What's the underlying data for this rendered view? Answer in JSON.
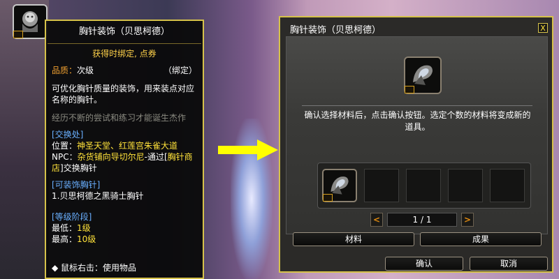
{
  "tooltip": {
    "title": "胸针装饰（贝思柯德）",
    "bind_note": "获得时绑定, 点券",
    "grade_label": "品质：",
    "grade_value": "次级",
    "bound_status": "（绑定）",
    "description": "可优化胸针质量的装饰，用来装点对应名称的胸针。",
    "flavor": "经历不断的尝试和练习才能诞生杰作",
    "exchange_header": "[交换处]",
    "location_label": "位置：",
    "location_value": "神圣天堂、红莲宫朱雀大道",
    "npc_label": "NPC：",
    "npc_value": "杂货铺向导切尔尼",
    "npc_via": "-通过[",
    "npc_shop": "胸针商店",
    "npc_suffix": "]交换胸针",
    "equip_header": "[可装饰胸针]",
    "equip_item": "1.贝思柯德之黑骑士胸针",
    "level_header": "[等级阶段]",
    "min_label": "最低：",
    "min_value": "1级",
    "max_label": "最高：",
    "max_value": "10级",
    "footer": "◆ 鼠标右击：使用物品"
  },
  "dialog": {
    "title": "胸针装饰（贝思柯德）",
    "close": "X",
    "instruction": "确认选择材料后，点击确认按钮。选定个数的材料将变成新的道具。",
    "page": "1 / 1",
    "prev": "<",
    "next": ">",
    "tab_material": "材料",
    "tab_result": "成果",
    "confirm": "确认",
    "cancel": "取消"
  },
  "colors": {
    "accent_border": "#d6c24a",
    "orange": "#f0a030",
    "yellow": "#ffe23a",
    "blue": "#6ab0ff"
  },
  "icons": {
    "item": "brooch-decoration-icon",
    "arrow": "yellow-right-arrow-icon"
  }
}
